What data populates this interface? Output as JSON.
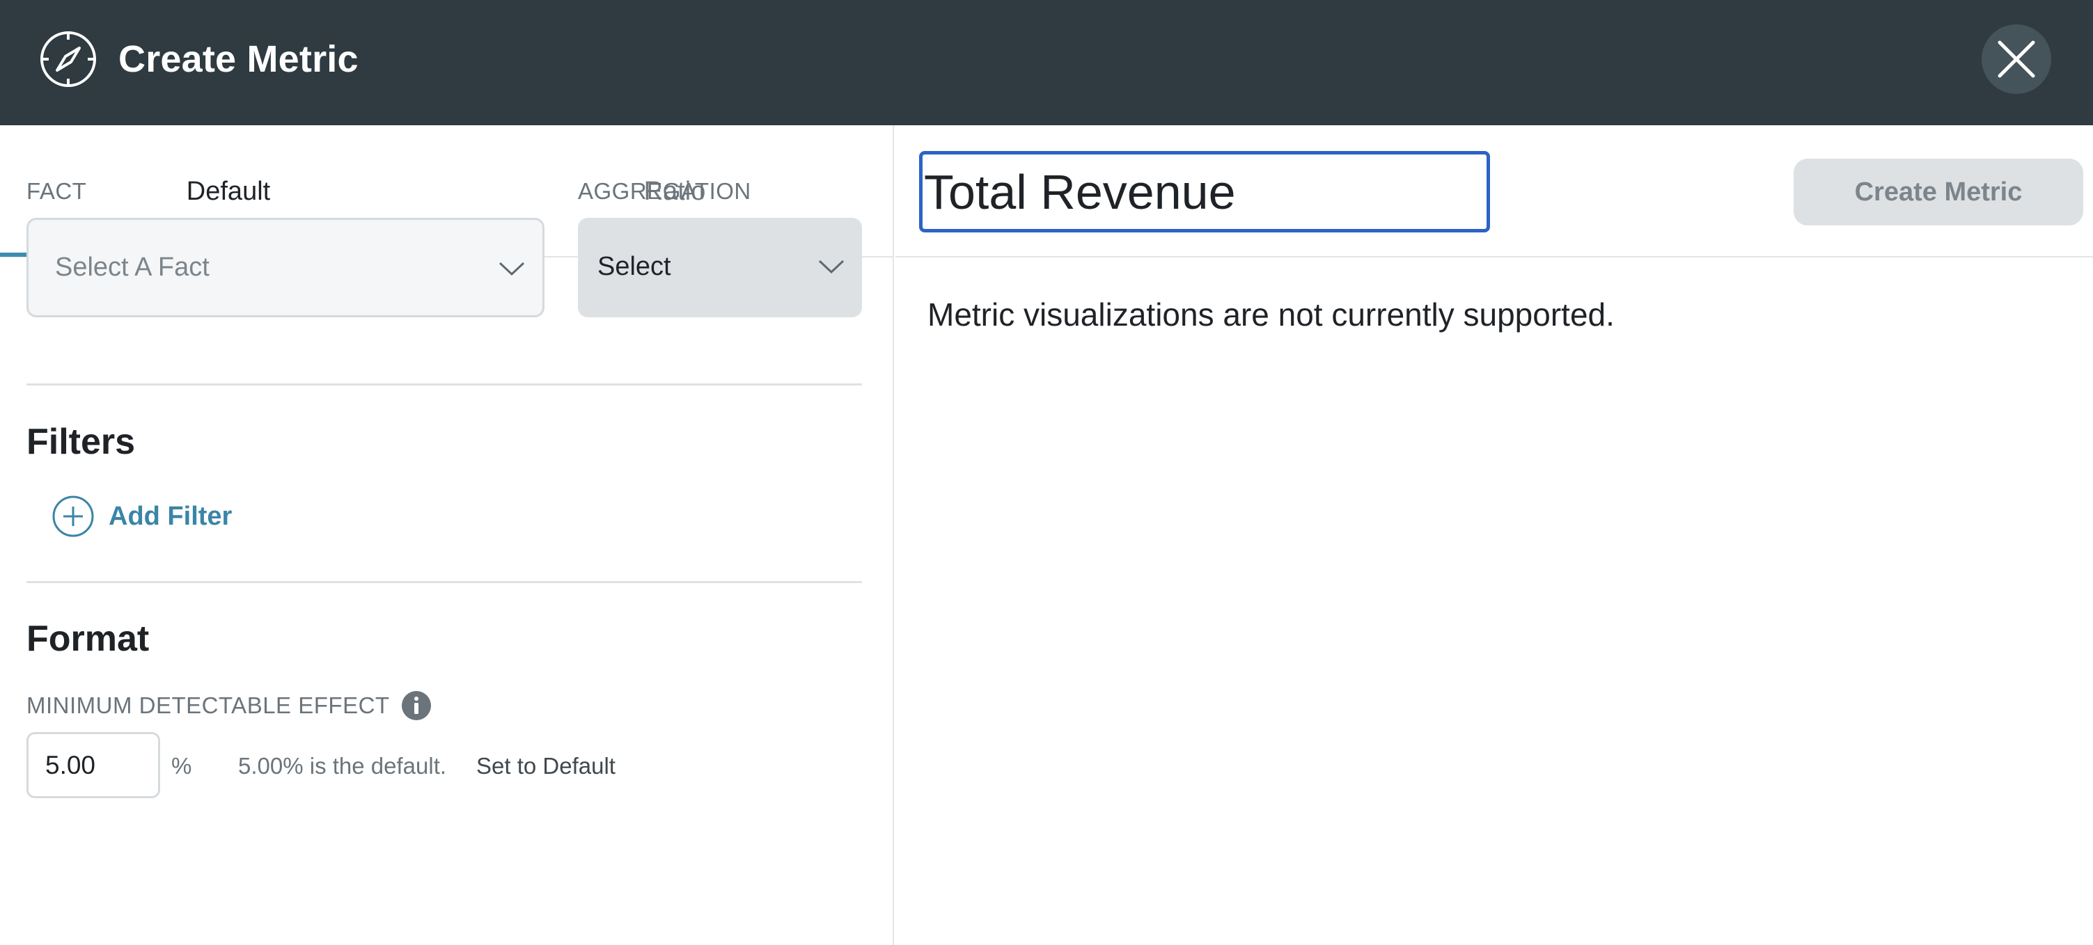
{
  "header": {
    "title": "Create Metric",
    "logo_icon": "compass-icon",
    "close_icon": "close-icon"
  },
  "tabs": [
    {
      "label": "Default",
      "active": true
    },
    {
      "label": "Ratio",
      "active": false
    }
  ],
  "fact": {
    "label": "FACT",
    "placeholder": "Select A Fact"
  },
  "aggregation": {
    "label": "AGGREGATION",
    "value": "Select"
  },
  "filters": {
    "heading": "Filters",
    "add_label": "Add Filter"
  },
  "format": {
    "heading": "Format",
    "mde_label": "MINIMUM DETECTABLE EFFECT",
    "mde_value": "5.00",
    "unit": "%",
    "default_note": "5.00% is the default.",
    "set_default_label": "Set to Default"
  },
  "metric": {
    "name_value": "Total Revenue",
    "create_button_label": "Create Metric",
    "visualization_message": "Metric visualizations are not currently supported."
  },
  "colors": {
    "header_bg": "#2f3b41",
    "accent": "#3d8db1",
    "focus_border": "#2b63c6"
  }
}
